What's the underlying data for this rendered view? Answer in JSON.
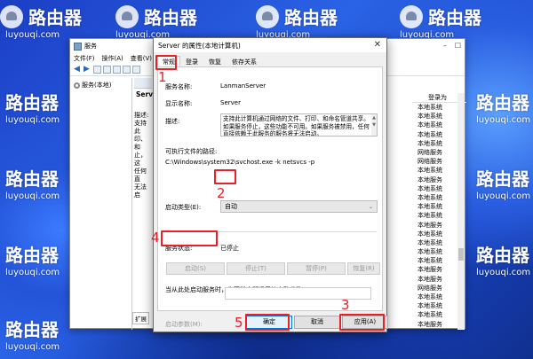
{
  "watermark": {
    "brand": "路由器",
    "site": "luyouqi.com"
  },
  "services_window": {
    "title": "服务",
    "menu": [
      "文件(F)",
      "操作(A)",
      "查看(V)"
    ],
    "tree_item": "服务(本地)",
    "detail_title": "Server",
    "detail_lines": [
      "描述:",
      "支持此",
      "印、和",
      "止，这",
      "任何直",
      "无法启"
    ],
    "bottom_tab": "扩展",
    "list_header": "登录为",
    "rows": [
      {
        "c1": "",
        "c2": "本地系统"
      },
      {
        "c1": "",
        "c2": "本地系统"
      },
      {
        "c1": "",
        "c2": "本地系统"
      },
      {
        "c1": "",
        "c2": "本地系统"
      },
      {
        "c1": "",
        "c2": "本地系统"
      },
      {
        "c1": "",
        "c2": "网络服务"
      },
      {
        "c1": "",
        "c2": "网络服务"
      },
      {
        "c1": "",
        "c2": "本地系统"
      },
      {
        "c1": "",
        "c2": "本地服务"
      },
      {
        "c1": "",
        "c2": "本地系统"
      },
      {
        "c1": "",
        "c2": "本地系统"
      },
      {
        "c1": "",
        "c2": "本地系统"
      },
      {
        "c1": "",
        "c2": "本地系统"
      },
      {
        "c1": "",
        "c2": "本地服务"
      },
      {
        "c1": "",
        "c2": "本地系统"
      },
      {
        "c1": "",
        "c2": "本地系统"
      },
      {
        "c1": "",
        "c2": "本地系统"
      },
      {
        "c1": "",
        "c2": "本地系统"
      },
      {
        "c1": "",
        "c2": "本地服务"
      },
      {
        "c1": "",
        "c2": "本地服务"
      },
      {
        "c1": "",
        "c2": "网络服务"
      },
      {
        "c1": "",
        "c2": "本地系统"
      },
      {
        "c1": "",
        "c2": "本地系统"
      },
      {
        "c1": "",
        "c2": "本地系统"
      },
      {
        "c1": "",
        "c2": "本地服务"
      }
    ]
  },
  "dialog": {
    "title": "Server 的属性(本地计算机)",
    "close": "✕",
    "tabs": [
      "常规",
      "登录",
      "恢复",
      "依存关系"
    ],
    "service_name_label": "服务名称:",
    "service_name": "LanmanServer",
    "display_name_label": "显示名称:",
    "display_name": "Server",
    "description_label": "描述:",
    "description": "支持此计算机通过网络的文件、打印、和命名管道共享。如果服务停止，这些功能不可用。如果服务被禁用，任何直接依赖于此服务的服务将无法启动。",
    "exe_path_label": "可执行文件的路径:",
    "exe_path": "C:\\Windows\\system32\\svchost.exe -k netsvcs -p",
    "startup_type_label": "启动类型(E):",
    "startup_type": "自动",
    "service_status_label": "服务状态:",
    "service_status": "已停止",
    "btn_start": "启动(S)",
    "btn_stop": "停止(T)",
    "btn_pause": "暂停(P)",
    "btn_resume": "恢复(R)",
    "hint": "当从此处启动服务时，你可指定所适用的启动参数。",
    "param_label": "启动参数(M):",
    "btn_ok": "确定",
    "btn_cancel": "取消",
    "btn_apply": "应用(A)"
  },
  "annotations": [
    "1",
    "2",
    "3",
    "4",
    "5"
  ],
  "colors": {
    "highlight": "#e8202a",
    "accent": "#0078d7"
  }
}
